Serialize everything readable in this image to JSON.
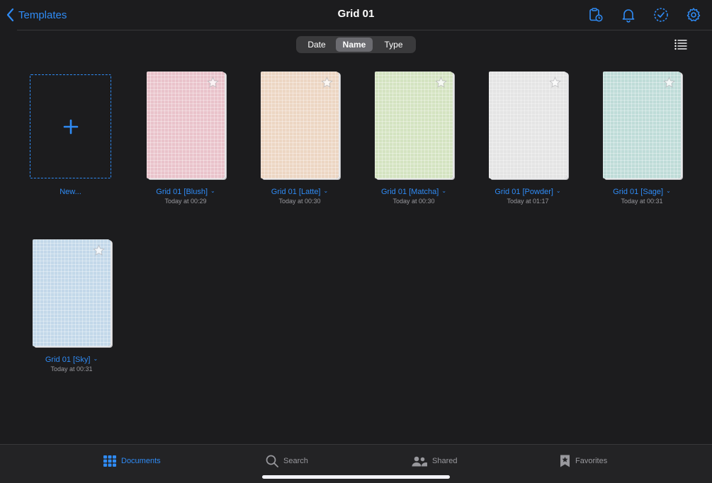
{
  "nav": {
    "back_label": "Templates",
    "title": "Grid 01",
    "icons": [
      "clipboard-clock-icon",
      "bell-icon",
      "check-circle-icon",
      "gear-icon"
    ]
  },
  "sort": {
    "options": [
      "Date",
      "Name",
      "Type"
    ],
    "selected": "Name"
  },
  "view_toggle": "list-icon",
  "new_card": {
    "label": "New..."
  },
  "documents": [
    {
      "name": "Grid 01 [Blush]",
      "date": "Today at 00:29",
      "color": "#e9c3cb"
    },
    {
      "name": "Grid 01 [Latte]",
      "date": "Today at 00:30",
      "color": "#ecd6c3"
    },
    {
      "name": "Grid 01 [Matcha]",
      "date": "Today at 00:30",
      "color": "#d4e3c1"
    },
    {
      "name": "Grid 01 [Powder]",
      "date": "Today at 01:17",
      "color": "#e4e4e4"
    },
    {
      "name": "Grid 01 [Sage]",
      "date": "Today at 00:31",
      "color": "#bfdcd8"
    },
    {
      "name": "Grid 01 [Sky]",
      "date": "Today at 00:31",
      "color": "#c3d8e9"
    }
  ],
  "tabs": [
    {
      "label": "Documents",
      "icon": "grid-icon",
      "active": true
    },
    {
      "label": "Search",
      "icon": "search-icon",
      "active": false
    },
    {
      "label": "Shared",
      "icon": "people-icon",
      "active": false
    },
    {
      "label": "Favorites",
      "icon": "bookmark-star-icon",
      "active": false
    }
  ],
  "colors": {
    "accent": "#2f8bf5",
    "background": "#1c1c1e",
    "secondary_text": "#98989d"
  }
}
